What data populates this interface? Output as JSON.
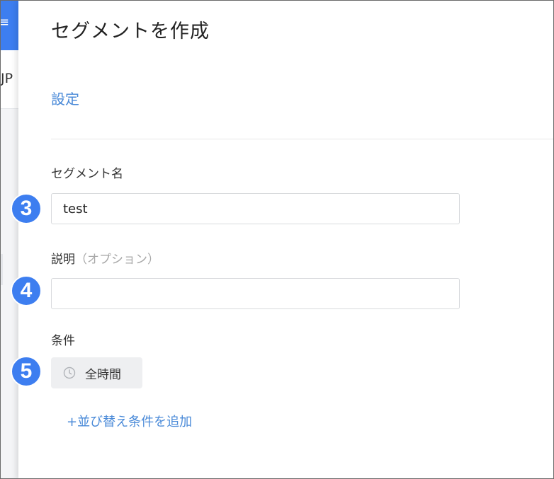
{
  "background": {
    "top_button_glyph": "≡",
    "partial_text": "JP"
  },
  "panel": {
    "title": "セグメントを作成",
    "section_tab": "設定",
    "fields": {
      "name": {
        "label": "セグメント名",
        "value": "test"
      },
      "description": {
        "label": "説明",
        "optional_note": "（オプション）",
        "value": "",
        "placeholder": ""
      },
      "conditions": {
        "label": "条件",
        "chip_label": "全時間",
        "chip_icon": "clock-icon"
      }
    },
    "add_sort_condition_link": "+並び替え条件を追加"
  },
  "step_markers": [
    "3",
    "4",
    "5"
  ],
  "colors": {
    "accent": "#3d7ef0",
    "link": "#4a8ad8",
    "chip_bg": "#eeeff1"
  }
}
